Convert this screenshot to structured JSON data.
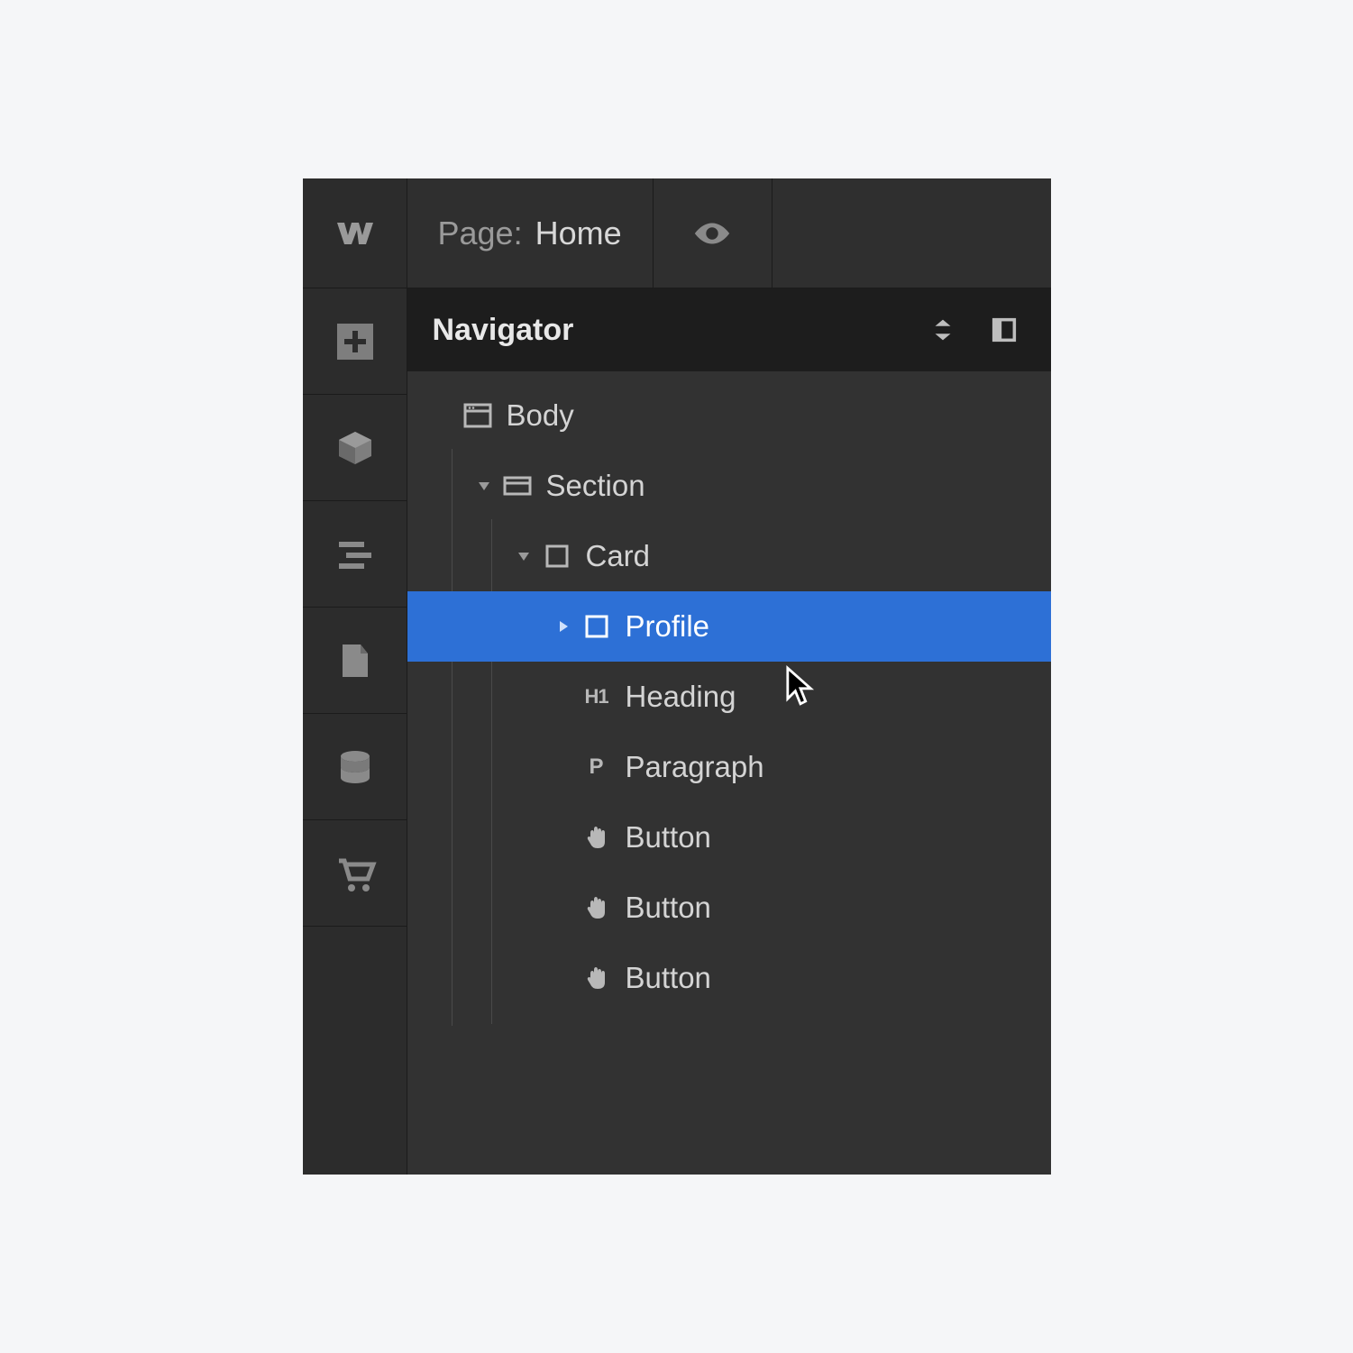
{
  "topbar": {
    "page_label": "Page:",
    "page_name": "Home"
  },
  "navigator": {
    "title": "Navigator"
  },
  "tree": [
    {
      "id": "body",
      "label": "Body",
      "icon": "browser",
      "depth": 0,
      "expandable": false,
      "expanded": false,
      "selected": false
    },
    {
      "id": "section",
      "label": "Section",
      "icon": "section",
      "depth": 1,
      "expandable": true,
      "expanded": true,
      "selected": false
    },
    {
      "id": "card",
      "label": "Card",
      "icon": "box",
      "depth": 2,
      "expandable": true,
      "expanded": true,
      "selected": false
    },
    {
      "id": "profile",
      "label": "Profile",
      "icon": "box",
      "depth": 3,
      "expandable": true,
      "expanded": false,
      "selected": true
    },
    {
      "id": "heading",
      "label": "Heading",
      "icon": "h1",
      "depth": 3,
      "expandable": false,
      "expanded": false,
      "selected": false
    },
    {
      "id": "paragraph",
      "label": "Paragraph",
      "icon": "p",
      "depth": 3,
      "expandable": false,
      "expanded": false,
      "selected": false
    },
    {
      "id": "button1",
      "label": "Button",
      "icon": "hand",
      "depth": 3,
      "expandable": false,
      "expanded": false,
      "selected": false
    },
    {
      "id": "button2",
      "label": "Button",
      "icon": "hand",
      "depth": 3,
      "expandable": false,
      "expanded": false,
      "selected": false
    },
    {
      "id": "button3",
      "label": "Button",
      "icon": "hand",
      "depth": 3,
      "expandable": false,
      "expanded": false,
      "selected": false
    }
  ],
  "icons": {
    "h1": "H1",
    "p": "P"
  },
  "colors": {
    "selected": "#2d70d6",
    "panel": "#2f2f2f",
    "header": "#1d1d1d"
  }
}
